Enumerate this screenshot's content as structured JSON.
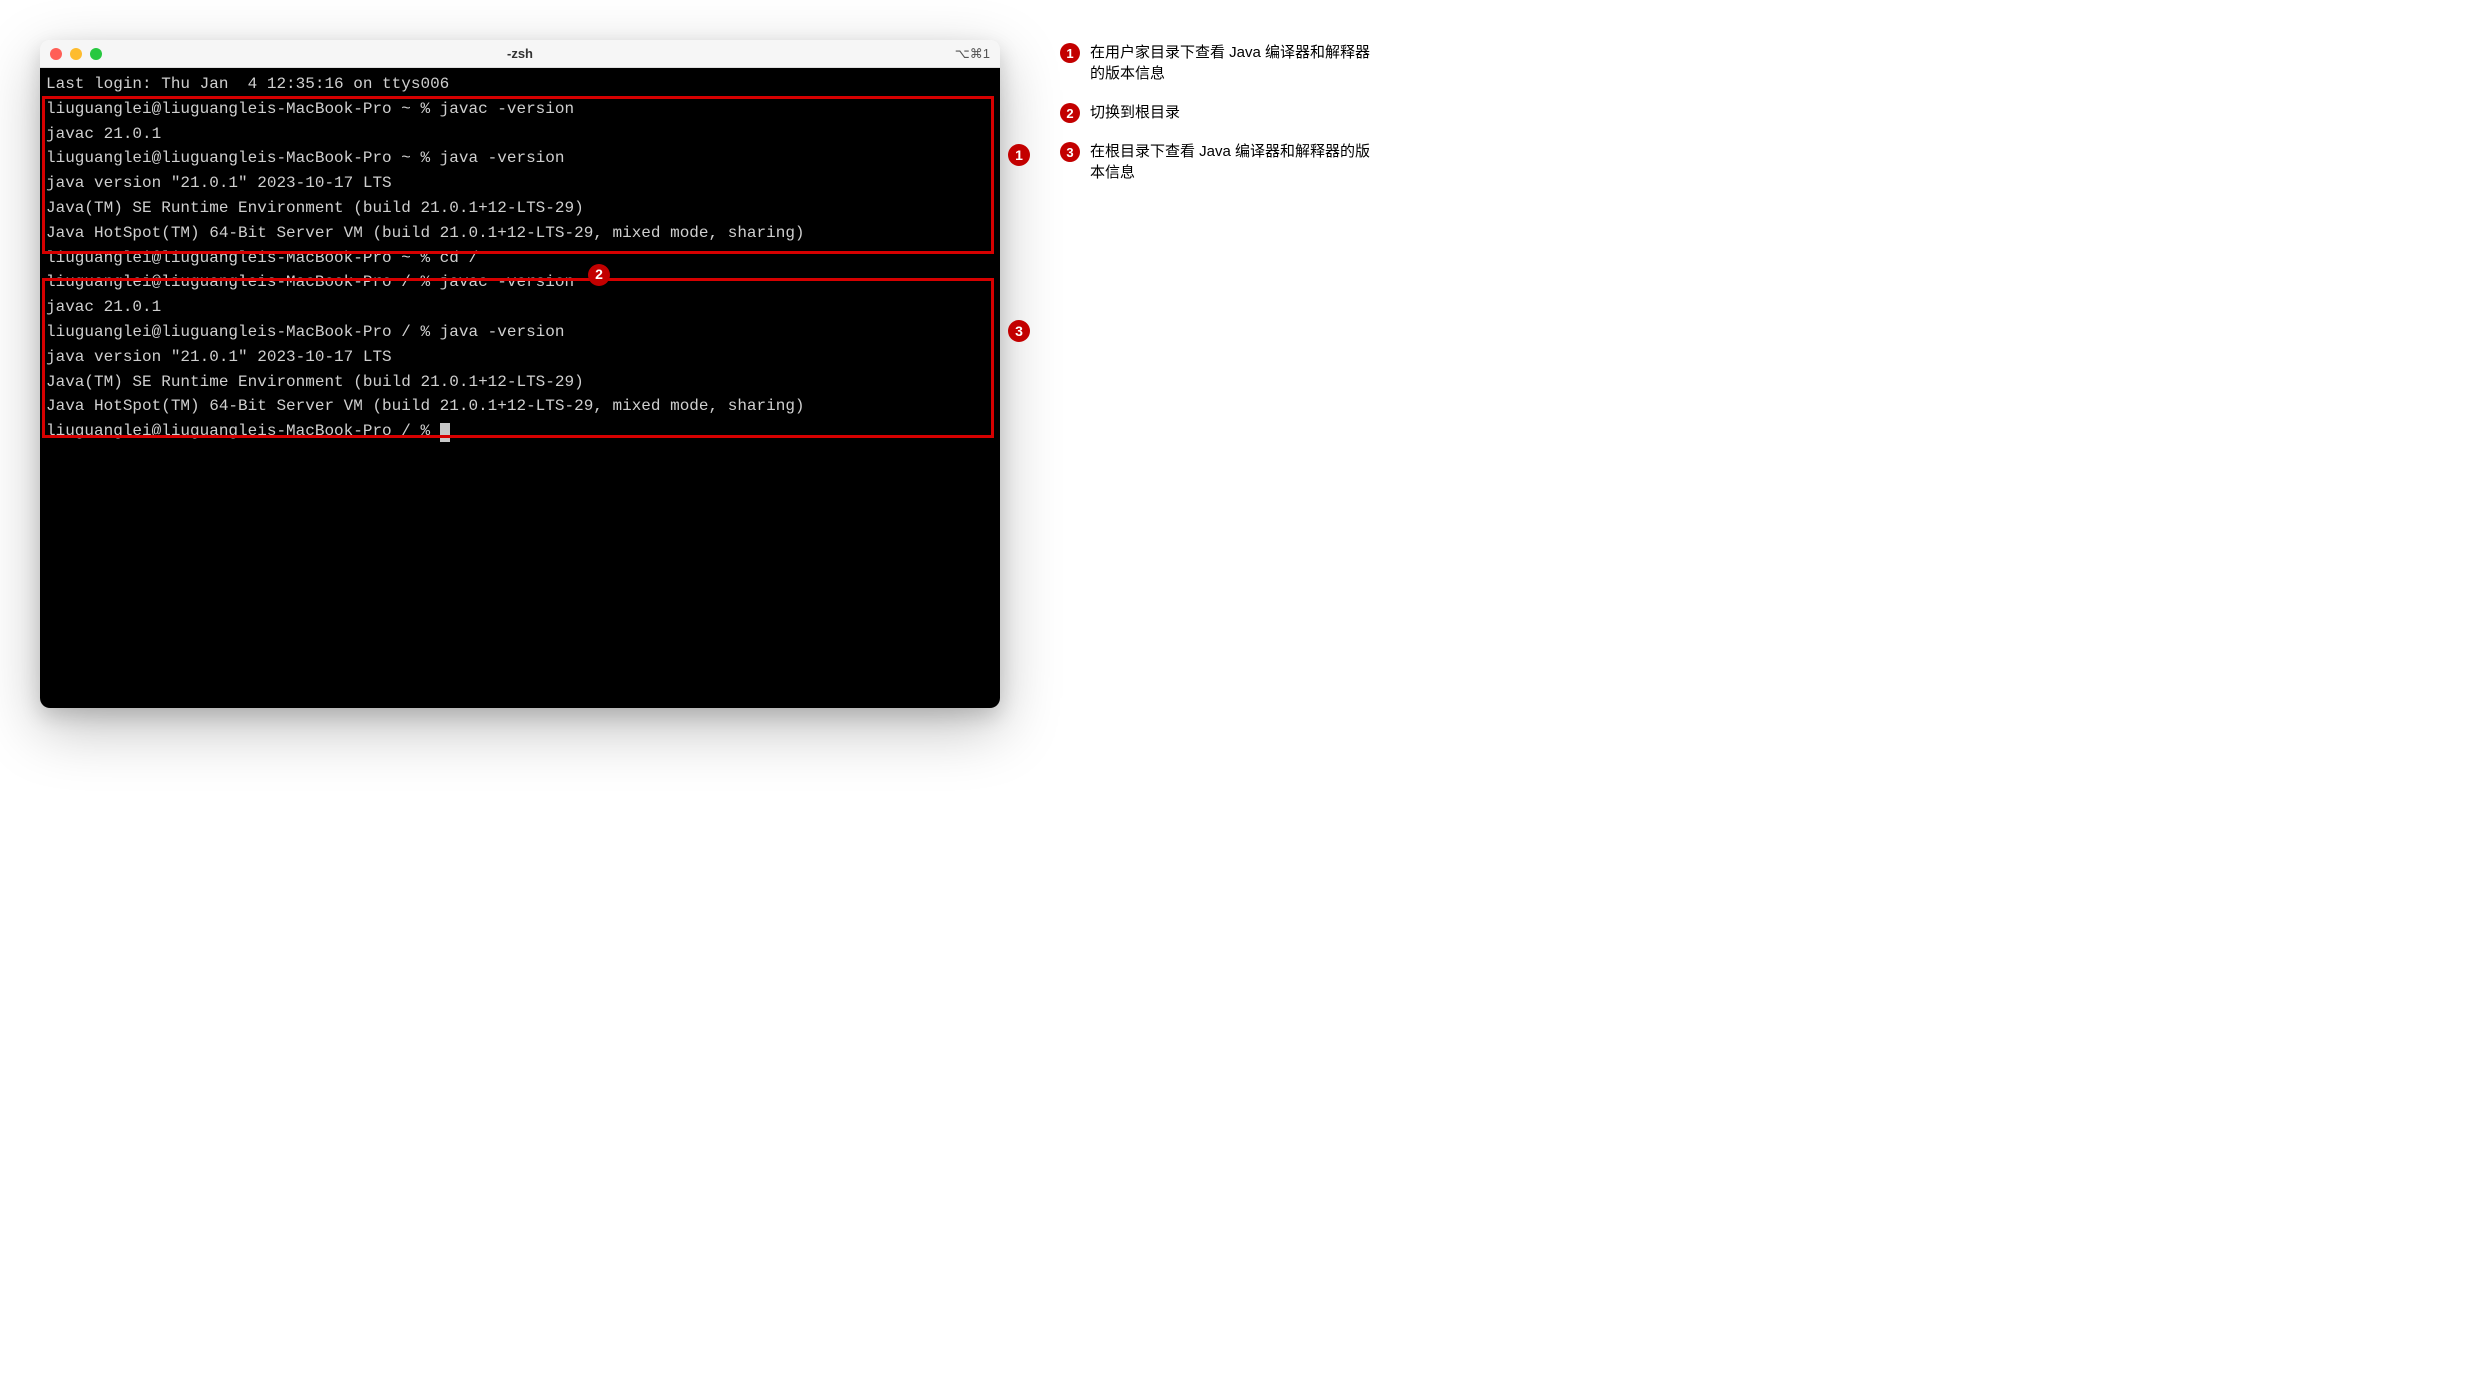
{
  "window": {
    "title": "-zsh",
    "shortcut": "⌥⌘1"
  },
  "terminal": {
    "lines": [
      "Last login: Thu Jan  4 12:35:16 on ttys006",
      "liuguanglei@liuguangleis-MacBook-Pro ~ % javac -version",
      "javac 21.0.1",
      "liuguanglei@liuguangleis-MacBook-Pro ~ % java -version",
      "java version \"21.0.1\" 2023-10-17 LTS",
      "Java(TM) SE Runtime Environment (build 21.0.1+12-LTS-29)",
      "Java HotSpot(TM) 64-Bit Server VM (build 21.0.1+12-LTS-29, mixed mode, sharing)",
      "liuguanglei@liuguangleis-MacBook-Pro ~ % cd /",
      "liuguanglei@liuguangleis-MacBook-Pro / % javac -version",
      "javac 21.0.1",
      "liuguanglei@liuguangleis-MacBook-Pro / % java -version",
      "java version \"21.0.1\" 2023-10-17 LTS",
      "Java(TM) SE Runtime Environment (build 21.0.1+12-LTS-29)",
      "Java HotSpot(TM) 64-Bit Server VM (build 21.0.1+12-LTS-29, mixed mode, sharing)"
    ],
    "prompt_final": "liuguanglei@liuguangleis-MacBook-Pro / % "
  },
  "callouts": {
    "badge1": "1",
    "badge2": "2",
    "badge3": "3"
  },
  "annotations": [
    {
      "num": "1",
      "text": "在用户家目录下查看 Java 编译器和解释器的版本信息"
    },
    {
      "num": "2",
      "text": "切换到根目录"
    },
    {
      "num": "3",
      "text": "在根目录下查看 Java 编译器和解释器的版本信息"
    }
  ]
}
